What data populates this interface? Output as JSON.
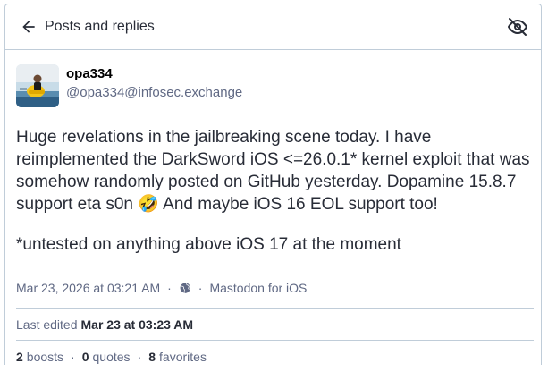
{
  "header": {
    "back_label": "Posts and replies"
  },
  "account": {
    "display_name": "opa334",
    "handle": "@opa334@infosec.exchange"
  },
  "content": {
    "paragraph1": "Huge revelations in the jailbreaking scene today. I have reimplemented the DarkSword iOS <=26.0.1* kernel exploit that was somehow randomly posted on GitHub yesterday. Dopamine 15.8.7 support eta s0n 🤣 And maybe iOS 16 EOL support too!",
    "paragraph2": "*untested on anything above iOS 17 at the moment"
  },
  "meta": {
    "timestamp": "Mar 23, 2026 at 03:21 AM",
    "dot": "·",
    "application": "Mastodon for iOS",
    "visibility_icon": "globe-icon"
  },
  "edited": {
    "prefix": "Last edited",
    "date": "Mar 23 at 03:23 AM"
  },
  "stats": {
    "boosts_count": "2",
    "boosts_label": "boosts",
    "quotes_count": "0",
    "quotes_label": "quotes",
    "favorites_count": "8",
    "favorites_label": "favorites",
    "separator": "·"
  },
  "icons": {
    "back": "arrow-left-icon",
    "hide": "eye-slash-icon"
  },
  "colors": {
    "text": "#282c37",
    "muted": "#606984",
    "border": "#c0cdd9"
  }
}
